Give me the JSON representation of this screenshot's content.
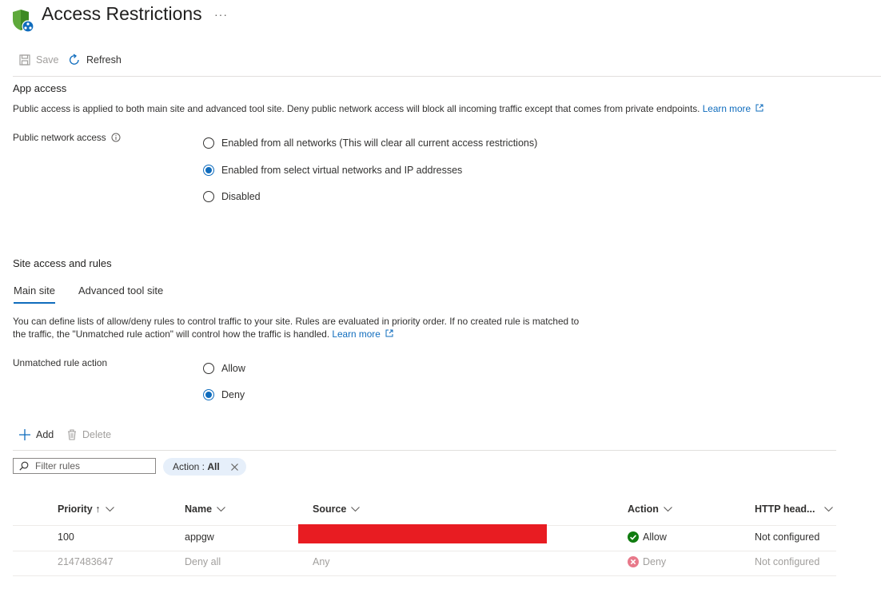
{
  "header": {
    "title": "Access Restrictions",
    "more": "···"
  },
  "toolbar": {
    "save_label": "Save",
    "refresh_label": "Refresh"
  },
  "app_access": {
    "heading": "App access",
    "description": "Public access is applied to both main site and advanced tool site. Deny public network access will block all incoming traffic except that comes from private endpoints.",
    "learn_more": "Learn more",
    "public_network_label": "Public network access",
    "options": [
      "Enabled from all networks (This will clear all current access restrictions)",
      "Enabled from select virtual networks and IP addresses",
      "Disabled"
    ],
    "selected_index": 1
  },
  "site_access": {
    "heading": "Site access and rules",
    "tabs": [
      "Main site",
      "Advanced tool site"
    ],
    "active_tab": 0,
    "description_line1": "You can define lists of allow/deny rules to control traffic to your site. Rules are evaluated in priority order. If no created rule is matched to",
    "description_line2": "the traffic, the \"Unmatched rule action\" will control how the traffic is handled.",
    "learn_more": "Learn more",
    "unmatched_label": "Unmatched rule action",
    "unmatched_options": [
      "Allow",
      "Deny"
    ],
    "unmatched_selected_index": 1
  },
  "rules_toolbar": {
    "add_label": "Add",
    "delete_label": "Delete"
  },
  "filter": {
    "placeholder": "Filter rules",
    "pill_prefix": "Action : ",
    "pill_value": "All"
  },
  "table": {
    "columns": [
      "Priority ↑",
      "Name",
      "Source",
      "Action",
      "HTTP head..."
    ],
    "rows": [
      {
        "priority": "100",
        "name": "appgw",
        "source": "",
        "action": "Allow",
        "http": "Not configured"
      },
      {
        "priority": "2147483647",
        "name": "Deny all",
        "source": "Any",
        "action": "Deny",
        "http": "Not configured"
      }
    ]
  },
  "colors": {
    "accent": "#0f6cbd",
    "allow": "#107c10",
    "deny": "#e8798a",
    "redaction": "#e81c22",
    "shield": "#5ea93b"
  }
}
